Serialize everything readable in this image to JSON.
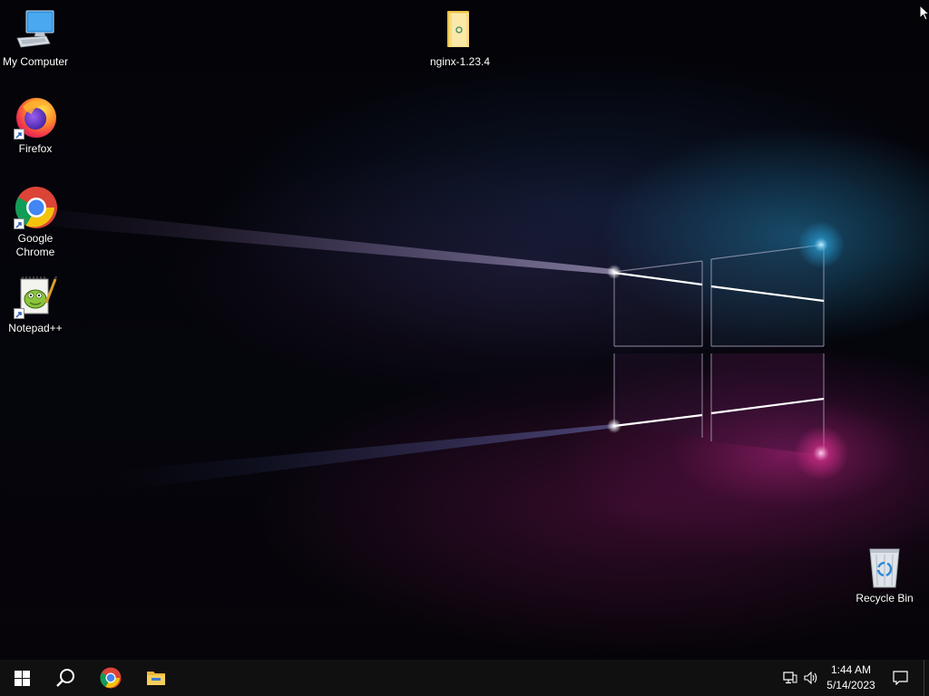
{
  "desktop": {
    "icons": [
      {
        "label": "My Computer",
        "icon": "computer-icon",
        "shortcut": false
      },
      {
        "label": "nginx-1.23.4",
        "icon": "folder-icon",
        "shortcut": false
      },
      {
        "label": "Firefox",
        "icon": "firefox-icon",
        "shortcut": true
      },
      {
        "label": "Google Chrome",
        "icon": "chrome-icon",
        "shortcut": true
      },
      {
        "label": "Notepad++",
        "icon": "notepadpp-icon",
        "shortcut": true
      },
      {
        "label": "Recycle Bin",
        "icon": "recycle-bin-icon",
        "shortcut": false
      }
    ]
  },
  "taskbar": {
    "buttons": [
      {
        "name": "start",
        "icon": "windows-logo-icon"
      },
      {
        "name": "search",
        "icon": "search-icon"
      },
      {
        "name": "chrome",
        "icon": "chrome-icon"
      },
      {
        "name": "file-explorer",
        "icon": "file-explorer-icon"
      }
    ],
    "tray": {
      "network_icon": "network-icon",
      "volume_icon": "volume-icon",
      "notifications_icon": "notifications-icon"
    },
    "clock": {
      "time": "1:44 AM",
      "date": "5/14/2023"
    }
  },
  "colors": {
    "taskbar_bg": "#101010",
    "accent_blue": "#2aa6e0",
    "accent_pink": "#e0308f"
  }
}
